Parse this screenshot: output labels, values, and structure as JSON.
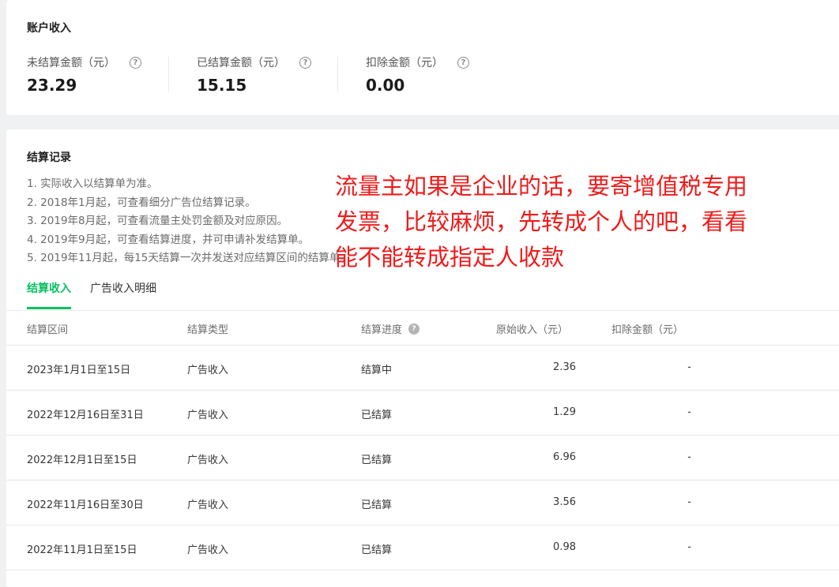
{
  "account": {
    "title": "账户收入",
    "metrics": [
      {
        "label": "未结算金额（元）",
        "value": "23.29"
      },
      {
        "label": "已结算金额（元）",
        "value": "15.15"
      },
      {
        "label": "扣除金额（元）",
        "value": "0.00"
      }
    ]
  },
  "settlement": {
    "title": "结算记录",
    "notes": [
      "1. 实际收入以结算单为准。",
      "2. 2018年1月起，可查看细分广告位结算记录。",
      "3. 2019年8月起，可查看流量主处罚金额及对应原因。",
      "4. 2019年9月起，可查看结算进度，并可申请补发结算单。",
      "5. 2019年11月起，每15天结算一次并发送对应结算区间的结算单。"
    ],
    "tabs": [
      {
        "label": "结算收入",
        "active": true
      },
      {
        "label": "广告收入明细",
        "active": false
      }
    ],
    "columns": {
      "period": "结算区间",
      "type": "结算类型",
      "progress": "结算进度",
      "original": "原始收入（元）",
      "deduction": "扣除金额（元）"
    },
    "rows": [
      {
        "period": "2023年1月1日至15日",
        "type": "广告收入",
        "progress": "结算中",
        "original": "2.36",
        "deduction": "-"
      },
      {
        "period": "2022年12月16日至31日",
        "type": "广告收入",
        "progress": "已结算",
        "original": "1.29",
        "deduction": "-"
      },
      {
        "period": "2022年12月1日至15日",
        "type": "广告收入",
        "progress": "已结算",
        "original": "6.96",
        "deduction": "-"
      },
      {
        "period": "2022年11月16日至30日",
        "type": "广告收入",
        "progress": "已结算",
        "original": "3.56",
        "deduction": "-"
      },
      {
        "period": "2022年11月1日至15日",
        "type": "广告收入",
        "progress": "已结算",
        "original": "0.98",
        "deduction": "-"
      }
    ]
  },
  "annotation": {
    "lines": [
      "流量主如果是企业的话，要寄增值税专用",
      "发票，比较麻烦，先转成个人的吧，看看",
      "能不能转成指定人收款"
    ],
    "color": "#ee1b1b"
  },
  "colors": {
    "accent": "#07c160",
    "background": "#f0f1f3"
  },
  "icons": {
    "help": "question-circle-icon"
  }
}
